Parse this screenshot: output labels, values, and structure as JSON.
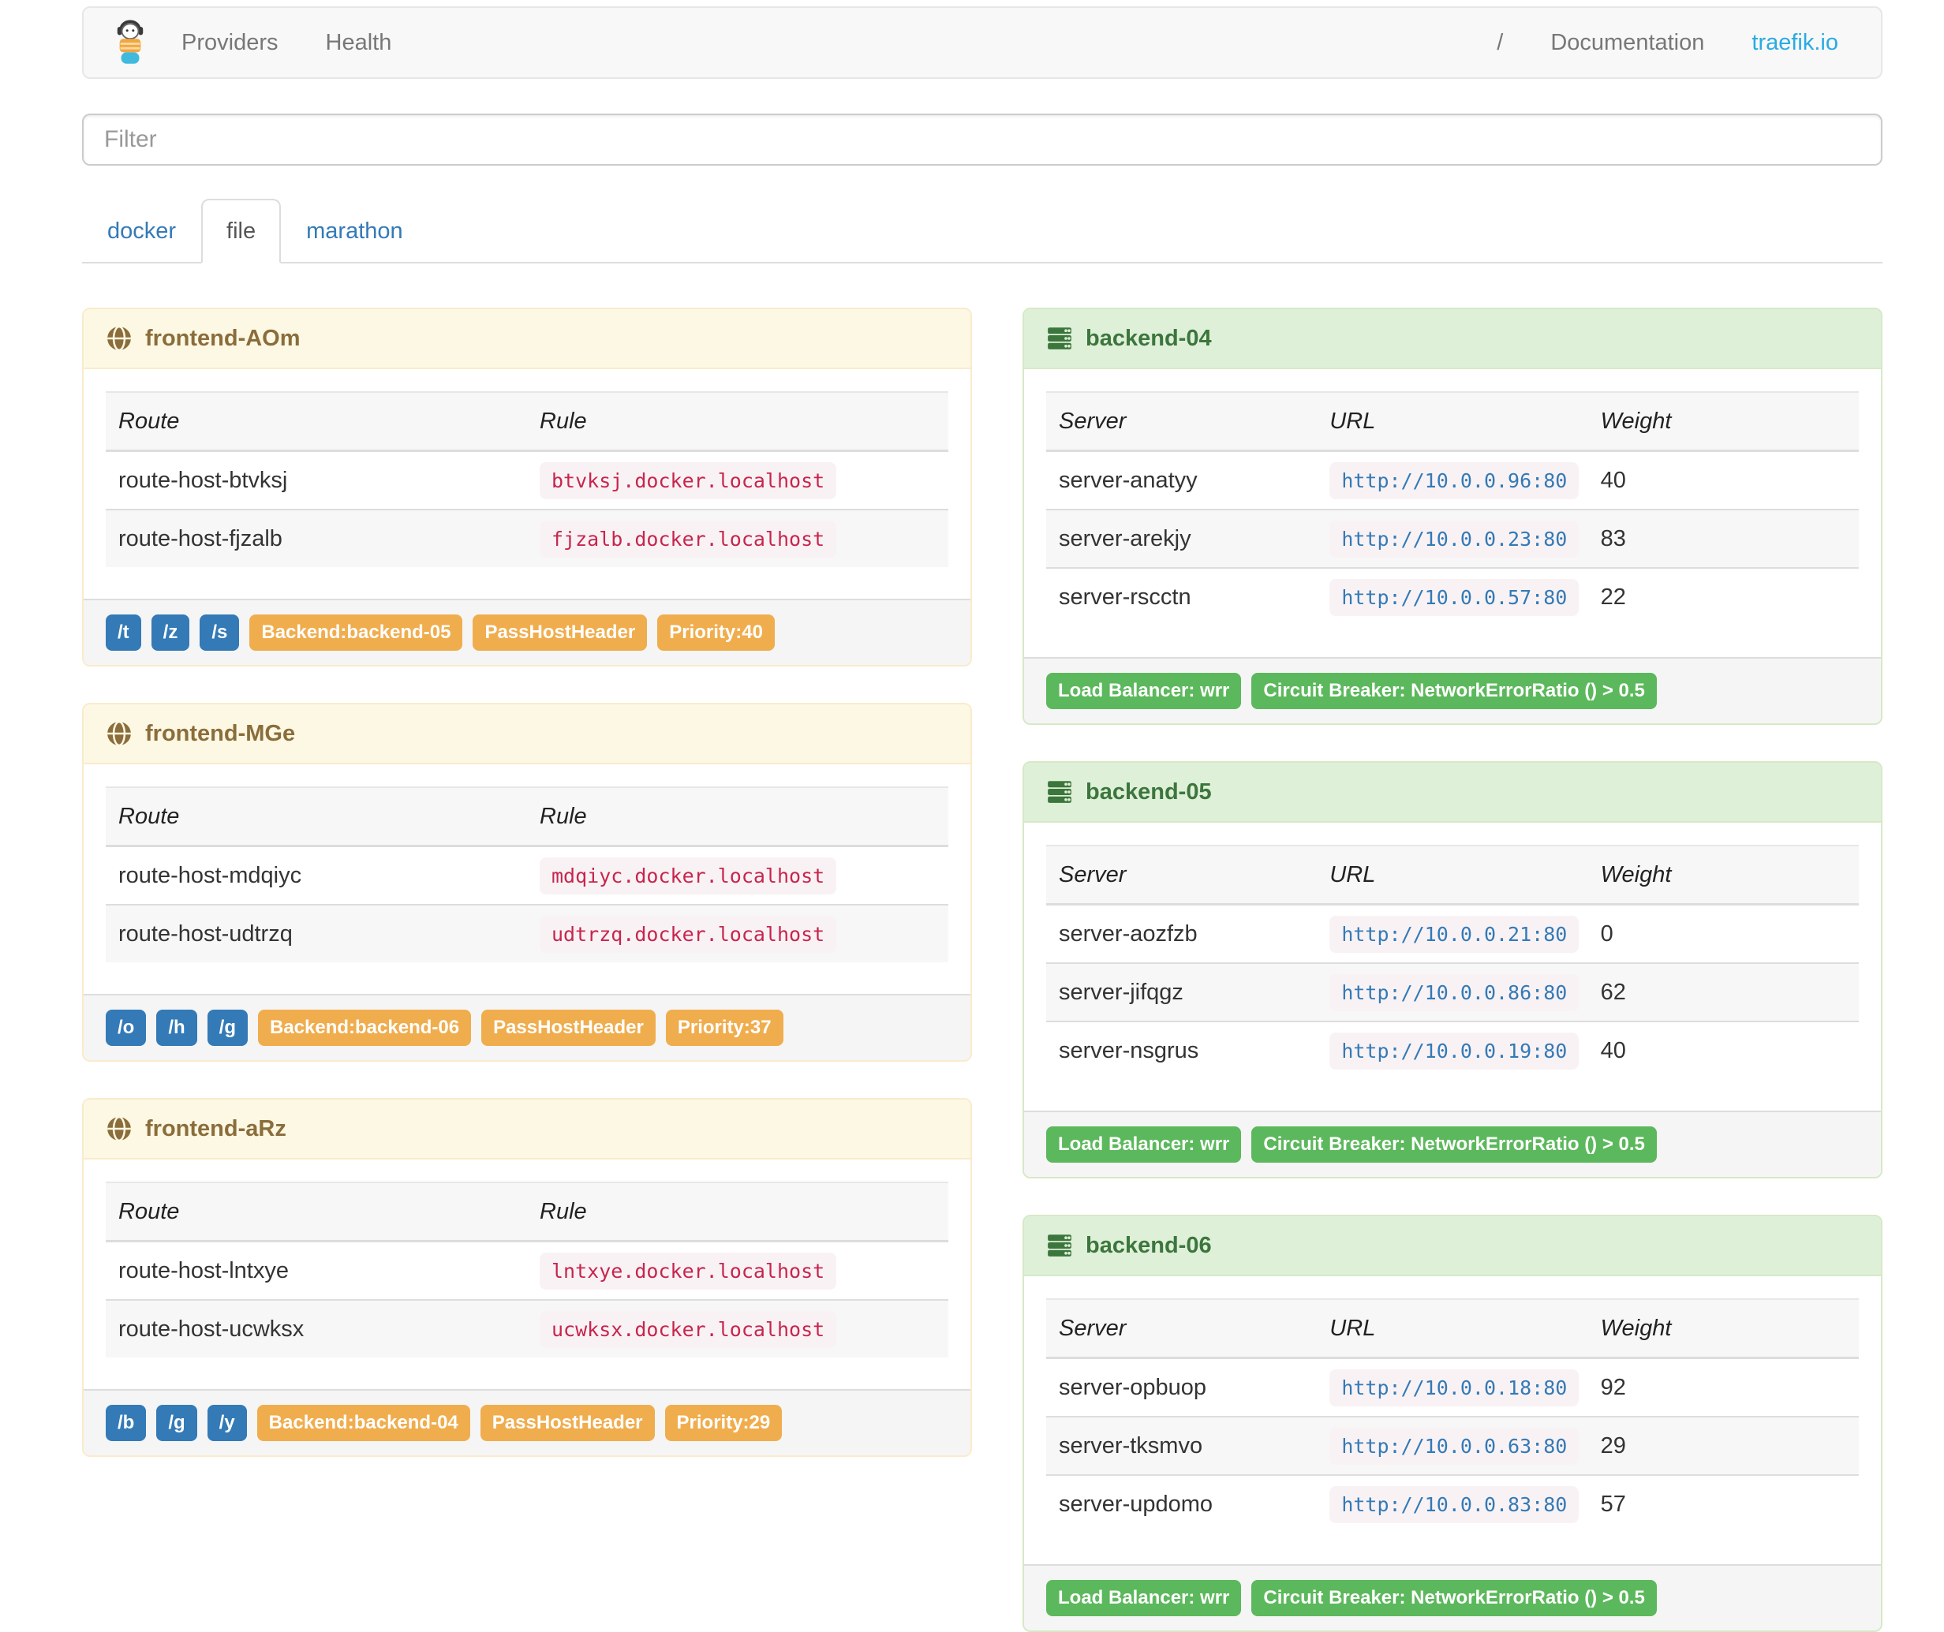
{
  "navbar": {
    "left_links": [
      "Providers",
      "Health"
    ],
    "right_links": [
      "/",
      "Documentation",
      "traefik.io"
    ]
  },
  "filter": {
    "placeholder": "Filter"
  },
  "tabs": [
    {
      "label": "docker",
      "active": false
    },
    {
      "label": "file",
      "active": true
    },
    {
      "label": "marathon",
      "active": false
    }
  ],
  "frontend_columns": [
    "Route",
    "Rule"
  ],
  "backend_columns": [
    "Server",
    "URL",
    "Weight"
  ],
  "frontends": [
    {
      "title": "frontend-AOm",
      "rows": [
        {
          "route": "route-host-btvksj",
          "rule": "btvksj.docker.localhost"
        },
        {
          "route": "route-host-fjzalb",
          "rule": "fjzalb.docker.localhost"
        }
      ],
      "tags_blue": [
        "/t",
        "/z",
        "/s"
      ],
      "tags_orange": [
        "Backend:backend-05",
        "PassHostHeader",
        "Priority:40"
      ]
    },
    {
      "title": "frontend-MGe",
      "rows": [
        {
          "route": "route-host-mdqiyc",
          "rule": "mdqiyc.docker.localhost"
        },
        {
          "route": "route-host-udtrzq",
          "rule": "udtrzq.docker.localhost"
        }
      ],
      "tags_blue": [
        "/o",
        "/h",
        "/g"
      ],
      "tags_orange": [
        "Backend:backend-06",
        "PassHostHeader",
        "Priority:37"
      ]
    },
    {
      "title": "frontend-aRz",
      "rows": [
        {
          "route": "route-host-lntxye",
          "rule": "lntxye.docker.localhost"
        },
        {
          "route": "route-host-ucwksx",
          "rule": "ucwksx.docker.localhost"
        }
      ],
      "tags_blue": [
        "/b",
        "/g",
        "/y"
      ],
      "tags_orange": [
        "Backend:backend-04",
        "PassHostHeader",
        "Priority:29"
      ]
    }
  ],
  "backends": [
    {
      "title": "backend-04",
      "rows": [
        {
          "server": "server-anatyy",
          "url": "http://10.0.0.96:80",
          "weight": "40"
        },
        {
          "server": "server-arekjy",
          "url": "http://10.0.0.23:80",
          "weight": "83"
        },
        {
          "server": "server-rscctn",
          "url": "http://10.0.0.57:80",
          "weight": "22"
        }
      ],
      "tags_green": [
        "Load Balancer: wrr",
        "Circuit Breaker: NetworkErrorRatio () > 0.5"
      ]
    },
    {
      "title": "backend-05",
      "rows": [
        {
          "server": "server-aozfzb",
          "url": "http://10.0.0.21:80",
          "weight": "0"
        },
        {
          "server": "server-jifqgz",
          "url": "http://10.0.0.86:80",
          "weight": "62"
        },
        {
          "server": "server-nsgrus",
          "url": "http://10.0.0.19:80",
          "weight": "40"
        }
      ],
      "tags_green": [
        "Load Balancer: wrr",
        "Circuit Breaker: NetworkErrorRatio () > 0.5"
      ]
    },
    {
      "title": "backend-06",
      "rows": [
        {
          "server": "server-opbuop",
          "url": "http://10.0.0.18:80",
          "weight": "92"
        },
        {
          "server": "server-tksmvo",
          "url": "http://10.0.0.63:80",
          "weight": "29"
        },
        {
          "server": "server-updomo",
          "url": "http://10.0.0.83:80",
          "weight": "57"
        }
      ],
      "tags_green": [
        "Load Balancer: wrr",
        "Circuit Breaker: NetworkErrorRatio () > 0.5"
      ]
    }
  ],
  "colors": {
    "accent_blue": "#29abe2",
    "link_blue": "#337ab7",
    "warning_text": "#8a6d3b",
    "warning_bg": "#fcf8e3",
    "success_text": "#3c763d",
    "success_bg": "#dff0d8",
    "label_warning": "#f0ad4e",
    "label_success": "#5cb85c",
    "code_text": "#c7254e",
    "code_bg": "#f9f2f4"
  }
}
